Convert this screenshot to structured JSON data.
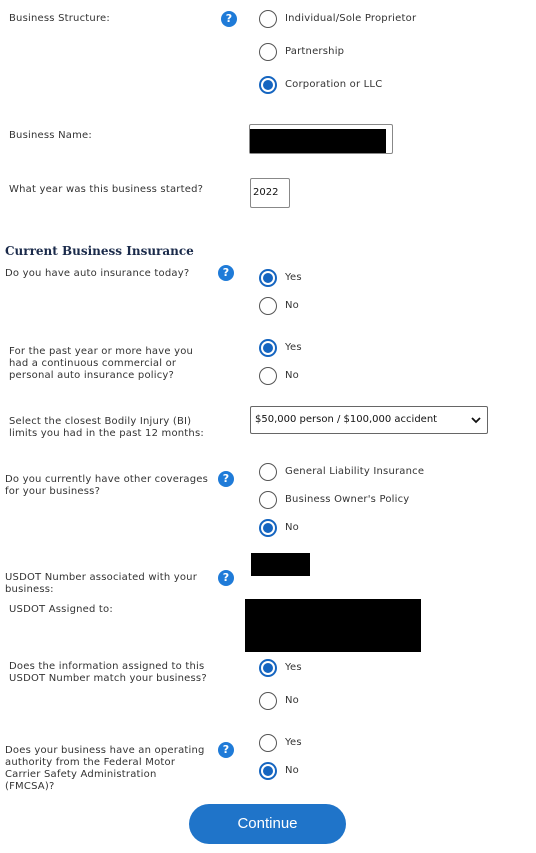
{
  "business_structure": {
    "label": "Business Structure:",
    "options": [
      {
        "label": "Individual/Sole Proprietor",
        "checked": false
      },
      {
        "label": "Partnership",
        "checked": false
      },
      {
        "label": "Corporation or LLC",
        "checked": true
      }
    ]
  },
  "business_name": {
    "label": "Business Name:"
  },
  "year_started": {
    "label": "What year was this business started?",
    "value": "2022"
  },
  "section_title": "Current Business Insurance",
  "auto_insurance": {
    "label": "Do you have auto insurance today?",
    "options": [
      {
        "label": "Yes",
        "checked": true
      },
      {
        "label": "No",
        "checked": false
      }
    ]
  },
  "continuous_policy": {
    "label_lines": [
      "For the past year or more have you",
      "had a continuous commercial or",
      "personal auto insurance policy?"
    ],
    "options": [
      {
        "label": "Yes",
        "checked": true
      },
      {
        "label": "No",
        "checked": false
      }
    ]
  },
  "bi_limits": {
    "label_lines": [
      "Select the closest Bodily Injury (BI)",
      "limits you had in the past 12 months:"
    ],
    "selected": "$50,000 person / $100,000 accident"
  },
  "other_coverages": {
    "label_lines": [
      "Do you currently have other coverages",
      "for your business?"
    ],
    "options": [
      {
        "label": "General Liability Insurance",
        "checked": false
      },
      {
        "label": "Business Owner's Policy",
        "checked": false
      },
      {
        "label": "No",
        "checked": true
      }
    ]
  },
  "usdot_number": {
    "label_lines": [
      "USDOT Number associated with your",
      "business:"
    ]
  },
  "usdot_assigned": {
    "label": "USDOT Assigned to:"
  },
  "usdot_match": {
    "label_lines": [
      "Does the information assigned to this",
      "USDOT Number match your business?"
    ],
    "options": [
      {
        "label": "Yes",
        "checked": true
      },
      {
        "label": "No",
        "checked": false
      }
    ]
  },
  "operating_authority": {
    "label_lines": [
      "Does your business have an operating",
      "authority from the Federal Motor",
      "Carrier Safety Administration",
      "(FMCSA)?"
    ],
    "options": [
      {
        "label": "Yes",
        "checked": false
      },
      {
        "label": "No",
        "checked": true
      }
    ]
  },
  "help_glyph": "?",
  "continue_label": "Continue",
  "colors": {
    "accent": "#1f74c9",
    "help": "#1f7bd8",
    "radio_checked": "#1565c0"
  }
}
